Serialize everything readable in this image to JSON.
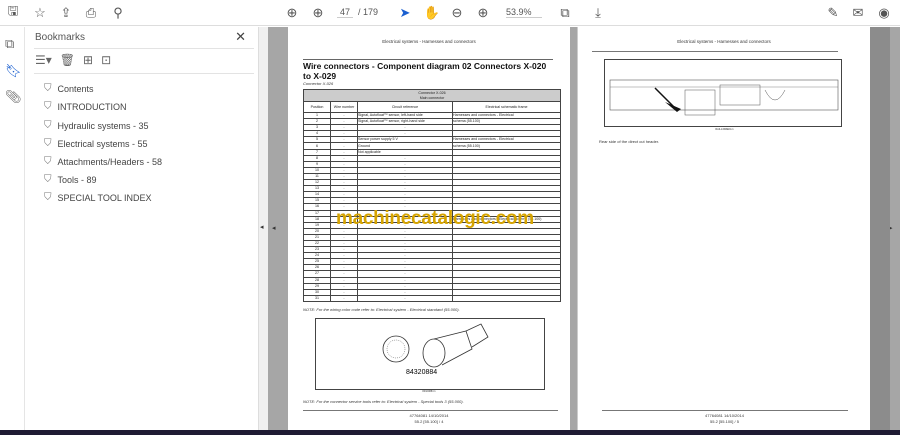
{
  "toolbar": {
    "page_current": "47",
    "page_total": "/ 179",
    "zoom": "53.9%"
  },
  "icons": {
    "save": "save-icon",
    "bookmark": "star-icon",
    "upload": "upload-icon",
    "print": "print-icon",
    "search": "search-zoom-icon"
  },
  "panel": {
    "title": "Bookmarks",
    "items": [
      "Contents",
      "INTRODUCTION",
      "Hydraulic systems - 35",
      "Electrical systems - 55",
      "Attachments/Headers - 58",
      "Tools - 89",
      "SPECIAL TOOL INDEX"
    ]
  },
  "left_page": {
    "header": "Electrical systems - Harnesses and connectors",
    "title": "Wire connectors - Component diagram 02 Connectors X-020 to X-029",
    "subtitle": "Connector X-026",
    "table": {
      "caption1": "Connector X-026",
      "caption2": "Main connector",
      "columns": [
        "Position",
        "Wire number",
        "Circuit reference",
        "Electrical schematic frame"
      ],
      "rows": [
        [
          "1",
          "-",
          "Signal, Autofloat™ sensor, left-hand side",
          "Harnesses and connectors - Electrical"
        ],
        [
          "2",
          "-",
          "Signal, Autofloat™ sensor, right-hand side",
          "schema (55.100)"
        ],
        [
          "3",
          "-",
          "-",
          ""
        ],
        [
          "4",
          "-",
          "-",
          ""
        ],
        [
          "5",
          "-",
          "Sensor power supply 5 V",
          "Harnesses and connectors - Electrical"
        ],
        [
          "6",
          "-",
          "Ground",
          "schema (55.100)"
        ],
        [
          "7",
          "-",
          "Not applicable",
          ""
        ],
        [
          "8",
          "-",
          "-",
          ""
        ],
        [
          "9",
          "-",
          "-",
          ""
        ],
        [
          "10",
          "-",
          "-",
          ""
        ],
        [
          "11",
          "-",
          "-",
          ""
        ],
        [
          "12",
          "-",
          "-",
          ""
        ],
        [
          "13",
          "-",
          "-",
          ""
        ],
        [
          "14",
          "-",
          "-",
          ""
        ],
        [
          "15",
          "-",
          "-",
          ""
        ],
        [
          "16",
          "-",
          "-",
          ""
        ],
        [
          "17",
          "-",
          "-",
          ""
        ],
        [
          "18",
          "-",
          "-",
          "Harnesses and connectors - Electrical schema (55.100)"
        ],
        [
          "19",
          "-",
          "-",
          ""
        ],
        [
          "20",
          "-",
          "-",
          ""
        ],
        [
          "21",
          "-",
          "-",
          ""
        ],
        [
          "22",
          "-",
          "-",
          ""
        ],
        [
          "23",
          "-",
          "-",
          ""
        ],
        [
          "24",
          "-",
          "-",
          ""
        ],
        [
          "25",
          "-",
          "-",
          ""
        ],
        [
          "26",
          "-",
          "-",
          ""
        ],
        [
          "27",
          "-",
          "-",
          ""
        ],
        [
          "28",
          "-",
          "-",
          ""
        ],
        [
          "29",
          "-",
          "-",
          ""
        ],
        [
          "30",
          "-",
          "-",
          ""
        ],
        [
          "31",
          "-",
          "-",
          ""
        ]
      ]
    },
    "note1": "NOTE: For the wiring color code refer to: Electrical system - Electrical standard (55.000).",
    "figure_label": "84320884",
    "figure_caption": "84320884  1",
    "note2": "NOTE: For the connector service tools refer to: Electrical system - Special tools 3 (55.000).",
    "footer1": "47764081 14/10/2014",
    "footer2": "55.2 [55.100] / 4"
  },
  "right_page": {
    "header": "Electrical systems - Harnesses and connectors",
    "figure_caption": "RAIL14SBEFA  1",
    "caption": "Rear side of the direct cut header.",
    "footer1": "47764081 14/10/2014",
    "footer2": "55.2 [55.100] / 5"
  },
  "watermark": "machinecatalogic.com"
}
